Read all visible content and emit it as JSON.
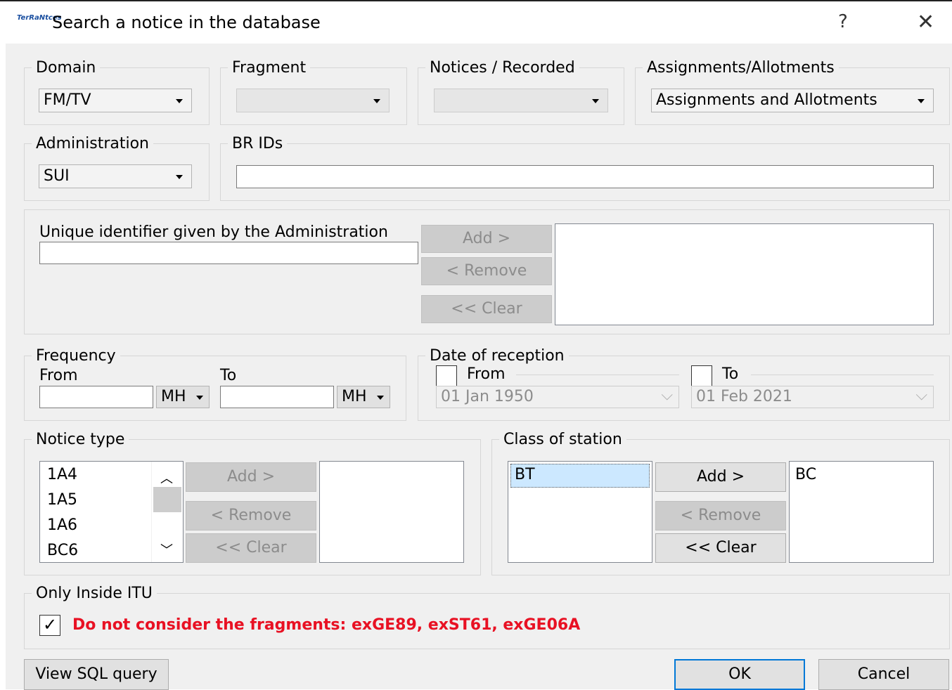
{
  "window": {
    "app_icon_text": "TerRaNtces",
    "title": "Search a notice in the database",
    "help": "?",
    "close": "✕"
  },
  "domain": {
    "legend": "Domain",
    "value": "FM/TV"
  },
  "fragment": {
    "legend": "Fragment",
    "value": ""
  },
  "notices_recorded": {
    "legend": "Notices / Recorded",
    "value": ""
  },
  "assignments": {
    "legend": "Assignments/Allotments",
    "value": "Assignments and Allotments"
  },
  "administration": {
    "legend": "Administration",
    "value": "SUI"
  },
  "br_ids": {
    "legend": "BR IDs",
    "value": ""
  },
  "unique_id": {
    "label": "Unique identifier given by the Administration",
    "value": "",
    "add": "Add >",
    "remove": "< Remove",
    "clear": "<< Clear"
  },
  "frequency": {
    "legend": "Frequency",
    "from_label": "From",
    "to_label": "To",
    "from_unit": "MH",
    "to_unit": "MH",
    "from_value": "",
    "to_value": ""
  },
  "date_of_reception": {
    "legend": "Date of reception",
    "from_label": "From",
    "to_label": "To",
    "from_date": "01 Jan 1950",
    "to_date": "01 Feb 2021",
    "from_checked": false,
    "to_checked": false
  },
  "notice_type": {
    "legend": "Notice type",
    "items": [
      "1A4",
      "1A5",
      "1A6",
      "BC6"
    ],
    "add": "Add >",
    "remove": "< Remove",
    "clear": "<< Clear"
  },
  "class_of_station": {
    "legend": "Class of station",
    "available": [
      "BT"
    ],
    "selected": [
      "BC"
    ],
    "add": "Add >",
    "remove": "< Remove",
    "clear": "<< Clear"
  },
  "only_inside_itu": {
    "legend": "Only Inside ITU",
    "checkbox_label": "Do not consider the fragments: exGE89, exST61, exGE06A",
    "checked": true,
    "warning_color": "#e81123"
  },
  "footer": {
    "view_sql": "View SQL query",
    "ok": "OK",
    "cancel": "Cancel"
  }
}
